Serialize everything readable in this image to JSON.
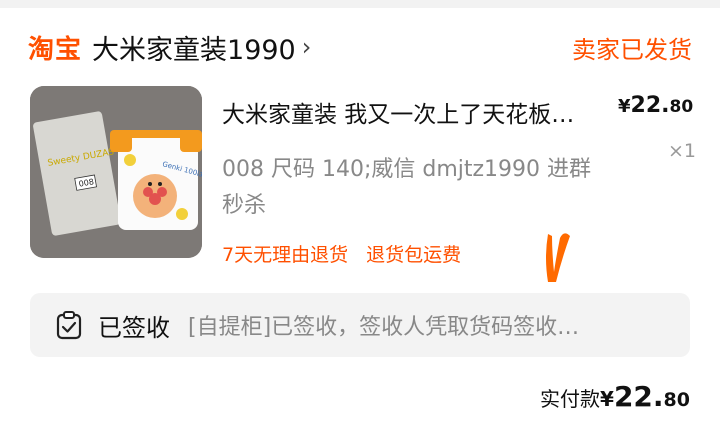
{
  "header": {
    "brand": "淘宝",
    "shop_name": "大米家童装1990",
    "order_status": "卖家已发货"
  },
  "item": {
    "title": "大米家童装 我又一次上了天花板…",
    "price_symbol": "¥",
    "price_int": "22.",
    "price_cents": "80",
    "quantity": "×1",
    "spec": "008 尺码 140;威信 dmjtz1990 进群秒杀",
    "tags": [
      "7天无理由退货",
      "退货包运费"
    ],
    "image_texts": {
      "bag_label": "Sweety DUZAS",
      "bag_number": "008",
      "shirt_text": "Genki 100ばい"
    }
  },
  "logistics": {
    "label": "已签收",
    "detail": "[自提柜]已签收，签收人凭取货码签收…"
  },
  "total": {
    "label": "实付款",
    "symbol": "¥",
    "int": "22.",
    "cents": "80"
  },
  "colors": {
    "accent": "#ff5000",
    "muted": "#888888",
    "notice_bg": "#f3f3f3"
  }
}
